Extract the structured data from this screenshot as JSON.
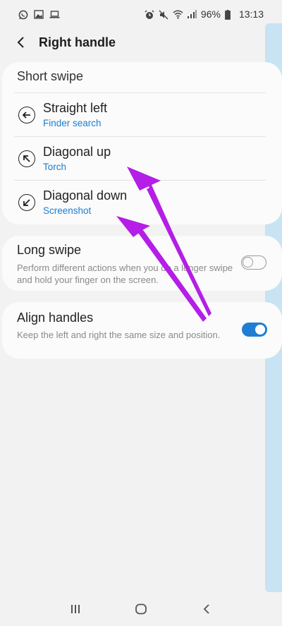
{
  "status_bar": {
    "left_icons": [
      "whatsapp-icon",
      "image-icon",
      "laptop-icon"
    ],
    "right_icons": [
      "alarm-icon",
      "mute-icon",
      "wifi-icon",
      "signal-icon"
    ],
    "battery": "96%",
    "time": "13:13"
  },
  "header": {
    "title": "Right handle",
    "back_icon": "chevron-left-icon"
  },
  "short_swipe": {
    "title": "Short swipe",
    "items": [
      {
        "icon": "arrow-left-circle-icon",
        "title": "Straight left",
        "action": "Finder search"
      },
      {
        "icon": "arrow-up-left-circle-icon",
        "title": "Diagonal up",
        "action": "Torch"
      },
      {
        "icon": "arrow-down-left-circle-icon",
        "title": "Diagonal down",
        "action": "Screenshot"
      }
    ]
  },
  "long_swipe": {
    "title": "Long swipe",
    "description": "Perform different actions when you do a longer swipe and hold your finger on the screen.",
    "enabled": false
  },
  "align_handles": {
    "title": "Align handles",
    "description": "Keep the left and right the same size and position.",
    "enabled": true
  },
  "nav_bar": {
    "buttons": [
      "recents-icon",
      "home-icon",
      "back-icon"
    ]
  },
  "colors": {
    "accent": "#1f7ed4",
    "annotation_arrow": "#b41ee6",
    "edge_handle": "#c8e3f3",
    "background": "#f2f2f2"
  }
}
